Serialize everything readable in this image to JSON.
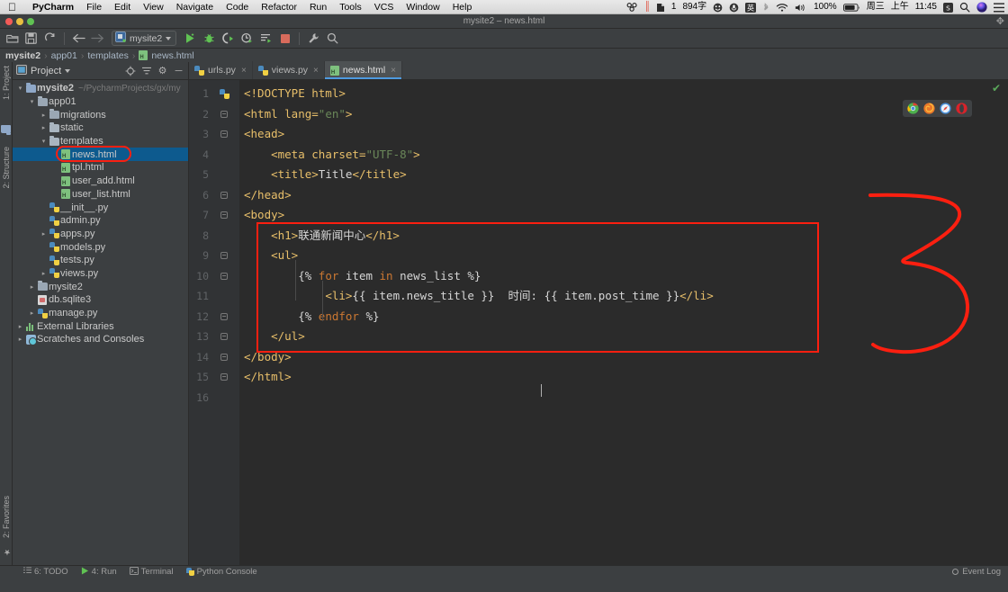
{
  "mac_menu": {
    "apple": "apple-logo",
    "items": [
      {
        "label": "PyCharm",
        "bold": true
      },
      {
        "label": "File",
        "bold": false
      },
      {
        "label": "Edit",
        "bold": false
      },
      {
        "label": "View",
        "bold": false
      },
      {
        "label": "Navigate",
        "bold": false
      },
      {
        "label": "Code",
        "bold": false
      },
      {
        "label": "Refactor",
        "bold": false
      },
      {
        "label": "Run",
        "bold": false
      },
      {
        "label": "Tools",
        "bold": false
      },
      {
        "label": "VCS",
        "bold": false
      },
      {
        "label": "Window",
        "bold": false
      },
      {
        "label": "Help",
        "bold": false
      }
    ],
    "right": {
      "dropbox_icon": "dropbox-icon",
      "bars_icon": "pause-bars-icon",
      "evernote_count": "1",
      "word_count": "894字",
      "smiley_icon": "smiley-icon",
      "mic_icon": "microphone-icon",
      "input_source": "英",
      "bluetooth_icon": "bluetooth-icon",
      "wifi_icon": "wifi-icon",
      "volume_icon": "volume-icon",
      "battery_percent": "100%",
      "battery_icon": "battery-icon",
      "day": "周三",
      "ampm": "上午",
      "time": "11:45",
      "sogou_icon": "sogou-icon",
      "spotlight_icon": "search-icon",
      "siri_icon": "siri-icon",
      "control_center_icon": "list-icon"
    }
  },
  "window": {
    "title": "mysite2 – news.html",
    "traffic_lights": [
      "close",
      "minimize",
      "zoom"
    ],
    "expand_icon": "expand-icon"
  },
  "toolbar": {
    "buttons": [
      {
        "name": "open-folder",
        "icon": "folder-open-icon"
      },
      {
        "name": "save-all",
        "icon": "save-icon"
      },
      {
        "name": "sync",
        "icon": "refresh-icon"
      },
      {
        "name": "back",
        "icon": "arrow-left-icon"
      },
      {
        "name": "forward",
        "icon": "arrow-right-icon"
      }
    ],
    "run_config": {
      "label": "mysite2",
      "icon": "django-config-icon"
    },
    "actions": [
      {
        "name": "run",
        "icon": "run-icon"
      },
      {
        "name": "debug",
        "icon": "debug-bug-icon"
      },
      {
        "name": "run-coverage",
        "icon": "coverage-icon"
      },
      {
        "name": "profile",
        "icon": "profile-icon"
      },
      {
        "name": "run-with-console",
        "icon": "console-run-icon"
      },
      {
        "name": "stop",
        "icon": "stop-icon"
      }
    ],
    "trailing": [
      {
        "name": "settings",
        "icon": "wrench-icon"
      },
      {
        "name": "search-everywhere",
        "icon": "search-icon"
      }
    ]
  },
  "breadcrumb": {
    "items": [
      {
        "label": "mysite2",
        "bold": true,
        "icon": null
      },
      {
        "label": "app01",
        "bold": false,
        "icon": null
      },
      {
        "label": "templates",
        "bold": false,
        "icon": null
      },
      {
        "label": "news.html",
        "bold": false,
        "icon": "html-file-icon"
      }
    ],
    "separator": "›"
  },
  "left_strip": {
    "top_labels": [
      {
        "label": "1: Project",
        "icon": "project-icon"
      },
      {
        "label": "2: Structure",
        "icon": "structure-icon"
      }
    ],
    "bottom_labels": [
      {
        "label": "2: Favorites",
        "icon": "star-icon"
      }
    ]
  },
  "project_panel": {
    "header": {
      "title": "Project",
      "caret": "chevron-down-icon",
      "icons": [
        {
          "name": "locate-icon",
          "glyph": "⊕"
        },
        {
          "name": "collapse-all-icon",
          "glyph": "≡"
        },
        {
          "name": "settings-gear-icon",
          "glyph": "⚙"
        },
        {
          "name": "hide-panel-icon",
          "glyph": "—"
        }
      ]
    },
    "tree": [
      {
        "label": "mysite2",
        "path": "~/PycharmProjects/gx/my",
        "indent": 0,
        "arrow": "down",
        "icon": "folder-project",
        "bold": true,
        "selected": false
      },
      {
        "label": "app01",
        "path": "",
        "indent": 1,
        "arrow": "down",
        "icon": "folder-source",
        "bold": false,
        "selected": false
      },
      {
        "label": "migrations",
        "path": "",
        "indent": 2,
        "arrow": "right",
        "icon": "folder-source",
        "bold": false,
        "selected": false
      },
      {
        "label": "static",
        "path": "",
        "indent": 2,
        "arrow": "right",
        "icon": "folder",
        "bold": false,
        "selected": false
      },
      {
        "label": "templates",
        "path": "",
        "indent": 2,
        "arrow": "down",
        "icon": "folder",
        "bold": false,
        "selected": false
      },
      {
        "label": "news.html",
        "path": "",
        "indent": 3,
        "arrow": "none",
        "icon": "html",
        "bold": false,
        "selected": true
      },
      {
        "label": "tpl.html",
        "path": "",
        "indent": 3,
        "arrow": "none",
        "icon": "html",
        "bold": false,
        "selected": false
      },
      {
        "label": "user_add.html",
        "path": "",
        "indent": 3,
        "arrow": "none",
        "icon": "html",
        "bold": false,
        "selected": false
      },
      {
        "label": "user_list.html",
        "path": "",
        "indent": 3,
        "arrow": "none",
        "icon": "html",
        "bold": false,
        "selected": false
      },
      {
        "label": "__init__.py",
        "path": "",
        "indent": 2,
        "arrow": "none",
        "icon": "py",
        "bold": false,
        "selected": false
      },
      {
        "label": "admin.py",
        "path": "",
        "indent": 2,
        "arrow": "none",
        "icon": "py",
        "bold": false,
        "selected": false
      },
      {
        "label": "apps.py",
        "path": "",
        "indent": 2,
        "arrow": "right",
        "icon": "py",
        "bold": false,
        "selected": false
      },
      {
        "label": "models.py",
        "path": "",
        "indent": 2,
        "arrow": "none",
        "icon": "py",
        "bold": false,
        "selected": false
      },
      {
        "label": "tests.py",
        "path": "",
        "indent": 2,
        "arrow": "none",
        "icon": "py",
        "bold": false,
        "selected": false
      },
      {
        "label": "views.py",
        "path": "",
        "indent": 2,
        "arrow": "right",
        "icon": "py",
        "bold": false,
        "selected": false
      },
      {
        "label": "mysite2",
        "path": "",
        "indent": 1,
        "arrow": "right",
        "icon": "folder-source",
        "bold": false,
        "selected": false
      },
      {
        "label": "db.sqlite3",
        "path": "",
        "indent": 1,
        "arrow": "none",
        "icon": "db",
        "bold": false,
        "selected": false
      },
      {
        "label": "manage.py",
        "path": "",
        "indent": 1,
        "arrow": "right",
        "icon": "py",
        "bold": false,
        "selected": false
      },
      {
        "label": "External Libraries",
        "path": "",
        "indent": 0,
        "arrow": "right",
        "icon": "lib",
        "bold": false,
        "selected": false
      },
      {
        "label": "Scratches and Consoles",
        "path": "",
        "indent": 0,
        "arrow": "right",
        "icon": "scratch",
        "bold": false,
        "selected": false
      }
    ]
  },
  "editor": {
    "tabs": [
      {
        "label": "urls.py",
        "icon": "py-file-icon",
        "active": false,
        "close": "×"
      },
      {
        "label": "views.py",
        "icon": "py-file-icon",
        "active": false,
        "close": "×"
      },
      {
        "label": "news.html",
        "icon": "html-file-icon",
        "active": true,
        "close": "×"
      }
    ],
    "inspection_status": "✔",
    "browsers": [
      {
        "name": "chrome-icon",
        "color": "#4db14d"
      },
      {
        "name": "firefox-icon",
        "color": "#e8772a"
      },
      {
        "name": "safari-icon",
        "color": "#4a90d9"
      },
      {
        "name": "opera-icon",
        "color": "#d8232a"
      }
    ],
    "lines": [
      {
        "num": "1",
        "fold": "none",
        "text": "<!DOCTYPE html>"
      },
      {
        "num": "2",
        "fold": "open",
        "text": "<html lang=\"en\">"
      },
      {
        "num": "3",
        "fold": "open",
        "text": "<head>"
      },
      {
        "num": "4",
        "fold": "none",
        "text": "    <meta charset=\"UTF-8\">"
      },
      {
        "num": "5",
        "fold": "none",
        "text": "    <title>Title</title>"
      },
      {
        "num": "6",
        "fold": "close",
        "text": "</head>"
      },
      {
        "num": "7",
        "fold": "open",
        "text": "<body>"
      },
      {
        "num": "8",
        "fold": "none",
        "text": "    <h1>联通新闻中心</h1>"
      },
      {
        "num": "9",
        "fold": "open",
        "text": "    <ul>"
      },
      {
        "num": "10",
        "fold": "open",
        "text": "        {% for item in news_list %}"
      },
      {
        "num": "11",
        "fold": "none",
        "text": "            <li>{{ item.news_title }}  时间: {{ item.post_time }}</li>"
      },
      {
        "num": "12",
        "fold": "close",
        "text": "        {% endfor %}"
      },
      {
        "num": "13",
        "fold": "close",
        "text": "    </ul>"
      },
      {
        "num": "14",
        "fold": "close",
        "text": "</body>"
      },
      {
        "num": "15",
        "fold": "close",
        "text": "</html>"
      },
      {
        "num": "16",
        "fold": "none",
        "text": ""
      }
    ]
  },
  "annotations": {
    "code_box_label": "red-rectangle-around-body-content",
    "sidebar_box_label": "red-rounded-rectangle-around-news-html",
    "hand_drawn": "3",
    "color": "#fb1f10"
  },
  "statusbar": {
    "items": [
      {
        "label": "6: TODO",
        "icon": "todo-icon"
      },
      {
        "label": "4: Run",
        "icon": "run-icon"
      },
      {
        "label": "Terminal",
        "icon": "terminal-icon"
      },
      {
        "label": "Python Console",
        "icon": "python-icon"
      }
    ],
    "right": {
      "label": "Event Log",
      "icon": "event-log-icon"
    }
  }
}
